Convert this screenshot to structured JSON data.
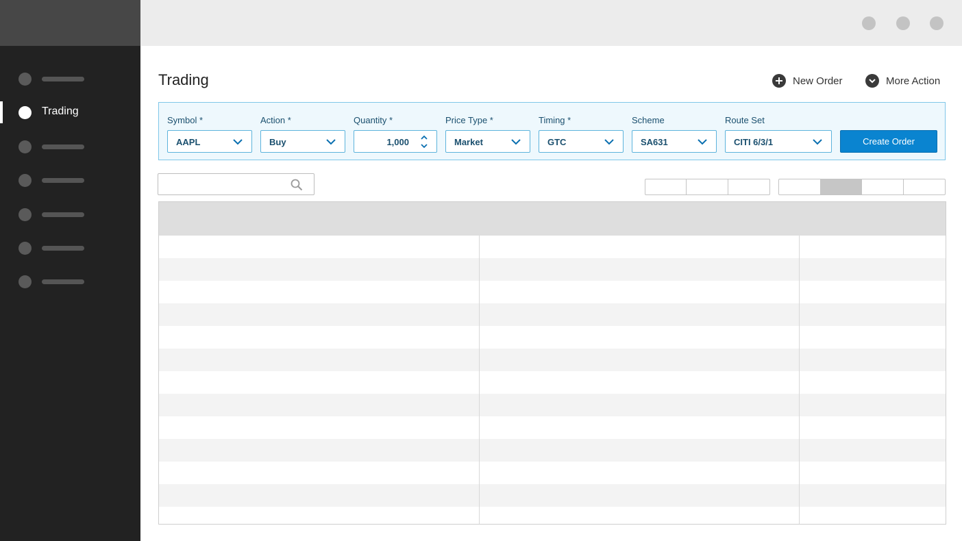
{
  "sidebar": {
    "items": [
      {
        "label": "",
        "active": false
      },
      {
        "label": "Trading",
        "active": true
      },
      {
        "label": "",
        "active": false
      },
      {
        "label": "",
        "active": false
      },
      {
        "label": "",
        "active": false
      },
      {
        "label": "",
        "active": false
      },
      {
        "label": "",
        "active": false
      }
    ]
  },
  "window_controls": [
    "circle-button",
    "circle-button",
    "circle-button"
  ],
  "page": {
    "title": "Trading",
    "actions": {
      "new_order": {
        "label": "New Order",
        "icon": "plus-circle-icon"
      },
      "more_action": {
        "label": "More Action",
        "icon": "chevron-down-circle-icon"
      }
    }
  },
  "order_form": {
    "symbol": {
      "label": "Symbol *",
      "value": "AAPL"
    },
    "action": {
      "label": "Action *",
      "value": "Buy"
    },
    "quantity": {
      "label": "Quantity *",
      "value": "1,000"
    },
    "price_type": {
      "label": "Price Type *",
      "value": "Market"
    },
    "timing": {
      "label": "Timing *",
      "value": "GTC"
    },
    "scheme": {
      "label": "Scheme",
      "value": "SA631"
    },
    "route_set": {
      "label": "Route Set",
      "value": "CITI 6/3/1"
    },
    "create_button": "Create Order"
  },
  "search": {
    "placeholder": "",
    "icon": "search-icon"
  },
  "view_toggles": {
    "group1_segments": 3,
    "group2_segments": 4,
    "group2_selected_index": 1
  },
  "table": {
    "columns": 3,
    "rows": 13
  },
  "colors": {
    "sidebar_bg": "#222222",
    "accent": "#0a84d0",
    "form_bg": "#eef8fd",
    "form_text": "#1a4f6e"
  }
}
